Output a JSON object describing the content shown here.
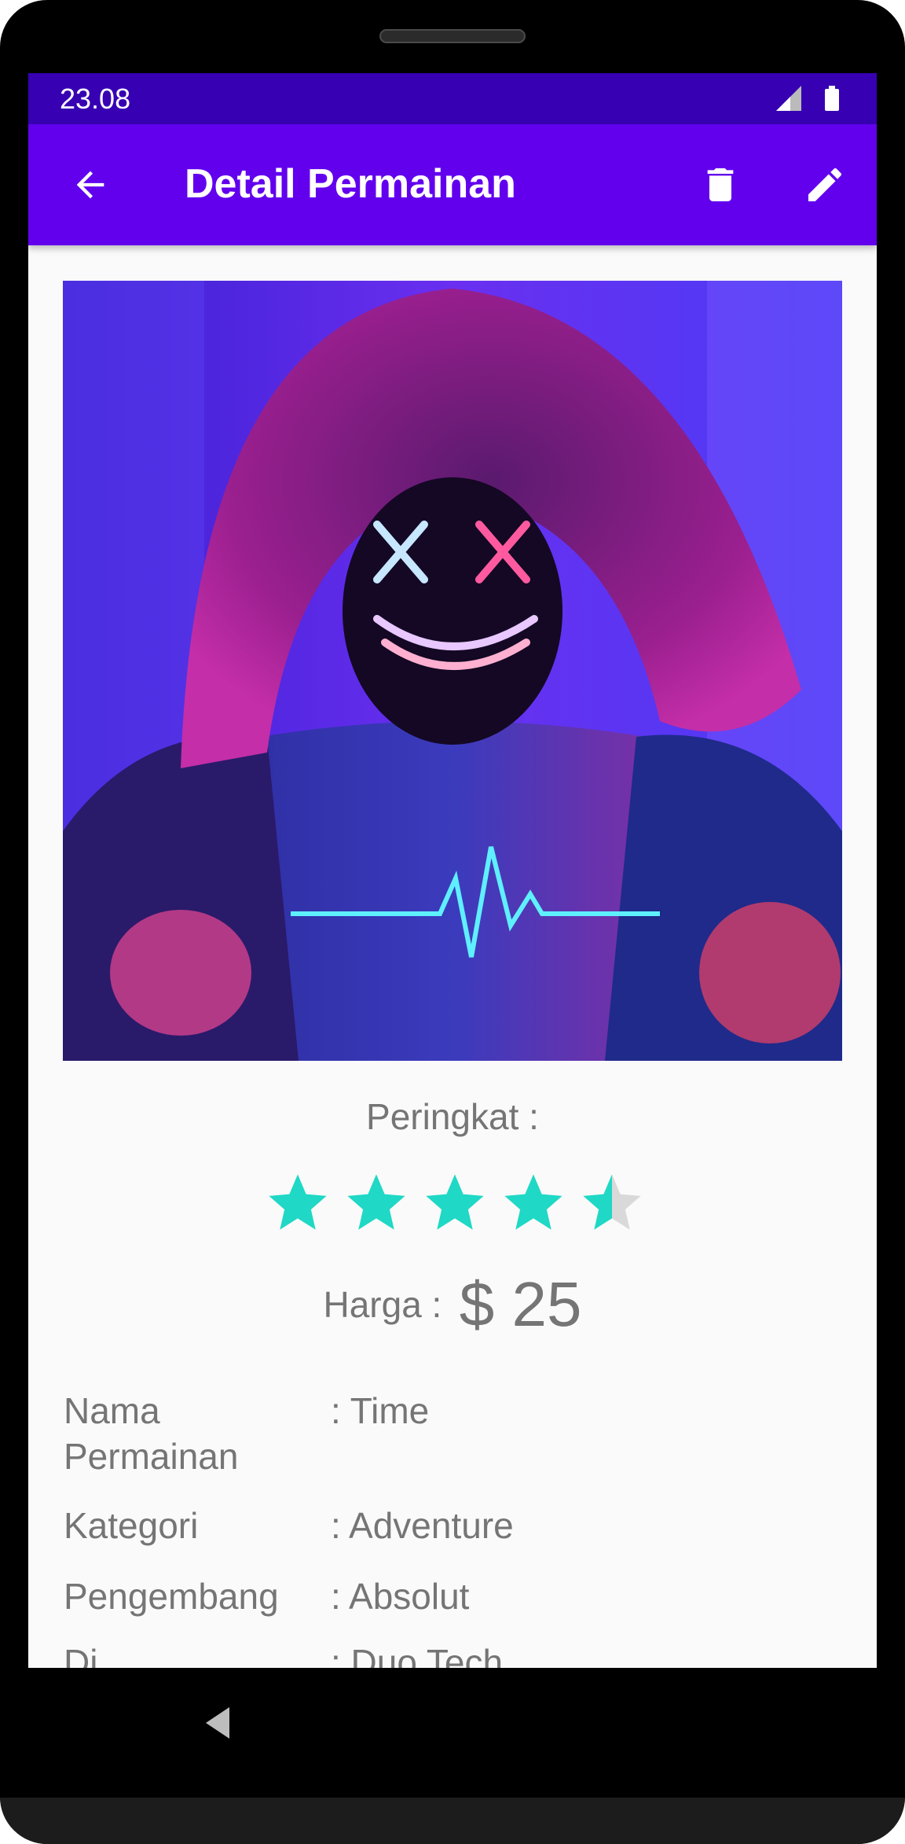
{
  "status_bar": {
    "time": "23.08"
  },
  "app_bar": {
    "title": "Detail Permainan"
  },
  "rating": {
    "label": "Peringkat :",
    "value": 4.5,
    "max": 5
  },
  "price": {
    "label": "Harga :",
    "value": "$ 25"
  },
  "details": [
    {
      "key": "Nama Permainan",
      "value": ": Time"
    },
    {
      "key": "Kategori",
      "value": ": Adventure"
    },
    {
      "key": "Pengembang",
      "value": ": Absolut"
    },
    {
      "key": "Di",
      "value": ": Duo Tech"
    }
  ],
  "colors": {
    "status_bar": "#3700b3",
    "app_bar": "#6200ee",
    "star_filled": "#1fd8c5",
    "star_empty": "#d9d9d9",
    "text_secondary": "#757575"
  },
  "icons": {
    "back": "arrow-left-icon",
    "delete": "trash-icon",
    "edit": "pencil-icon",
    "nav_back": "triangle-back-icon"
  }
}
